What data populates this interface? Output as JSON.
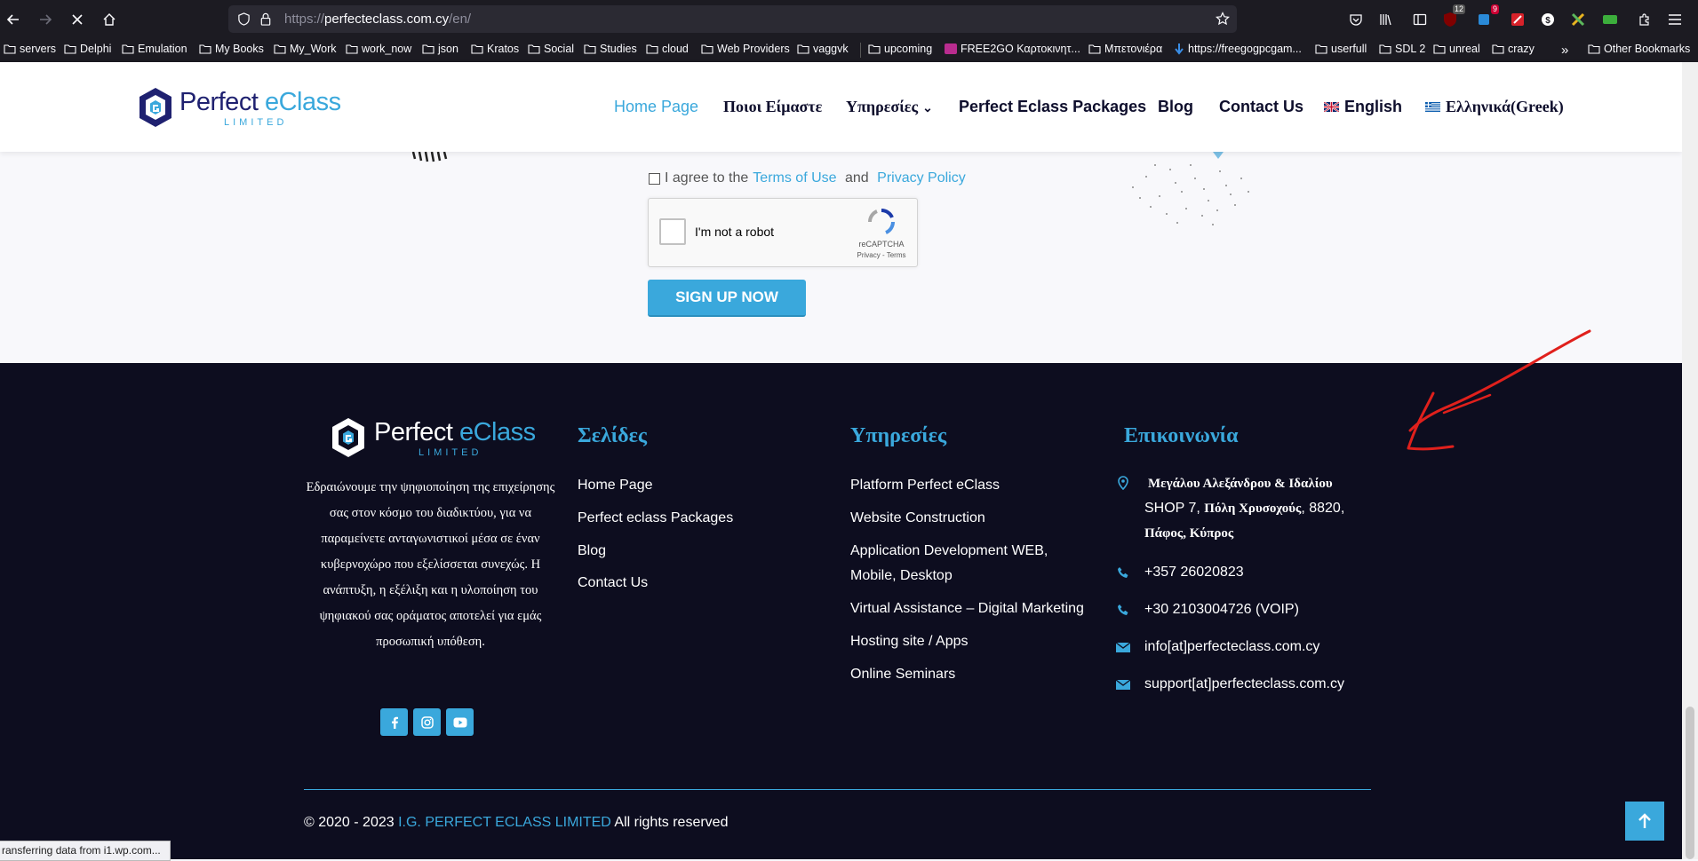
{
  "browser": {
    "url_prefix": "https://",
    "url_host": "perfecteclass.com.cy",
    "url_path": "/en/",
    "badges": {
      "ublock": "12",
      "ext2": "9"
    },
    "bookmarks": [
      "servers",
      "Delphi",
      "Emulation",
      "My Books",
      "My_Work",
      "work_now",
      "json",
      "Kratos",
      "Social",
      "Studies",
      "cloud",
      "Web Providers",
      "vaggvk",
      "upcoming",
      "FREE2GO Καρτοκινητ...",
      "Μπετονιέρα",
      "https://freegogpcgam...",
      "userfull",
      "SDL 2",
      "unreal",
      "crazy"
    ],
    "overflow": "»",
    "other_bookmarks": "Other Bookmarks",
    "status": "ransferring data from i1.wp.com..."
  },
  "header": {
    "logo_main_a": "Perfect ",
    "logo_main_b": "eClass",
    "logo_sub": "LIMITED",
    "menu": [
      "Home Page",
      "Ποιοι Είμαστε",
      "Υπηρεσίες",
      "Perfect Eclass Packages",
      "Blog",
      "Contact Us",
      "English",
      "Ελληνικά(Greek)"
    ],
    "dropdown_arrow": "⌄"
  },
  "form": {
    "agree_prefix": "I agree to the ",
    "terms": "Terms of Use",
    "and": " and ",
    "privacy": "Privacy Policy",
    "captcha_label": "I'm not a robot",
    "captcha_brand": "reCAPTCHA",
    "captcha_links": "Privacy - Terms",
    "signup": "SIGN UP NOW"
  },
  "footer": {
    "logo_main_a": "Perfect ",
    "logo_main_b": "eClass",
    "logo_sub": "LIMITED",
    "about": "Εδραιώνουμε την ψηφιοποίηση της επιχείρησης σας στον κόσμο του διαδικτύου, για να παραμείνετε ανταγωνιστικοί μέσα σε έναν κυβερνοχώρο που εξελίσσεται συνεχώς. Η ανάπτυξη, η εξέλιξη και η υλοποίηση του ψηφιακού σας οράματος αποτελεί για εμάς προσωπική υπόθεση.",
    "pages_title": "Σελίδες",
    "pages": [
      "Home Page",
      "Perfect eclass Packages",
      "Blog",
      "Contact Us"
    ],
    "services_title": "Υπηρεσίες",
    "services": [
      "Platform Perfect eClass",
      "Website Construction",
      "Application Development WEB, Mobile, Desktop",
      "Virtual Assistance – Digital Marketing",
      "Hosting site / Apps",
      "Online Seminars"
    ],
    "contact_title": "Επικοινωνία",
    "address_1": "Μεγάλου Αλεξάνδρου & Ιδαλίου",
    "address_2a": "SHOP 7, ",
    "address_2b": "Πόλη Χρυσοχούς",
    "address_2c": ", 8820,",
    "address_3": "Πάφος, Κύπρος",
    "phone_1": "+357 26020823",
    "phone_2": "+30 2103004726 (VOIP)",
    "email_1": "info[at]perfecteclass.com.cy",
    "email_2": "support[at]perfecteclass.com.cy",
    "copyright_a": "© 2020 - 2023 ",
    "copyright_b": "I.G. PERFECT ECLASS LIMITED",
    "copyright_c": " All rights reserved"
  },
  "colors": {
    "accent": "#3aa8dc",
    "footer_bg": "#0d0d1f",
    "annotation": "#e0201c"
  }
}
